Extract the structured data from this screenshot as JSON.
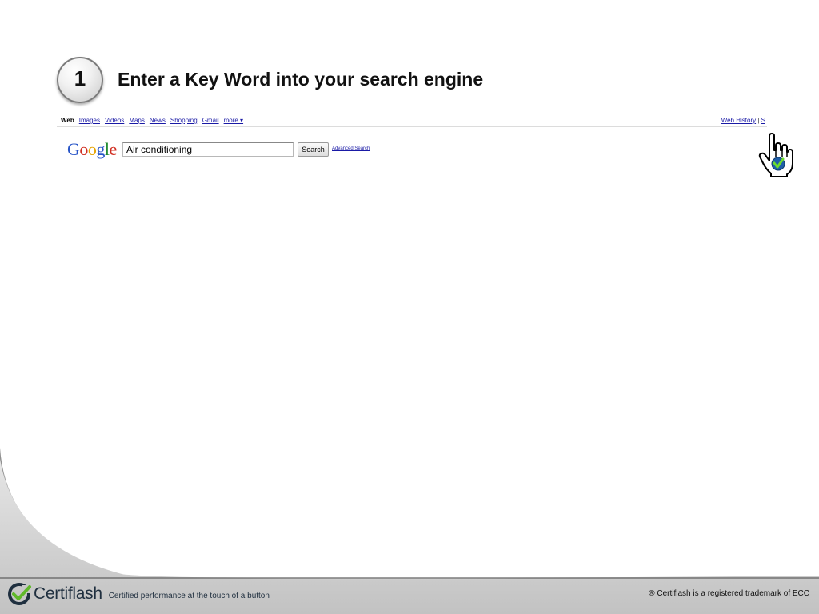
{
  "step": {
    "number": "1",
    "title": "Enter a Key Word into your search engine"
  },
  "google": {
    "nav": [
      "Web",
      "Images",
      "Videos",
      "Maps",
      "News",
      "Shopping",
      "Gmail",
      "more ▾"
    ],
    "active_nav": "Web",
    "right_links": {
      "web_history": "Web History",
      "separator": "|",
      "cut_off": "S"
    },
    "logo": [
      "G",
      "o",
      "o",
      "g",
      "l",
      "e"
    ],
    "search_value": "Air conditioning",
    "search_button": "Search",
    "advanced_link": "Advanced Search"
  },
  "footer": {
    "brand": "Certiflash",
    "tagline": "Certified performance at the touch of a button",
    "trademark": "® Certiflash is a registered trademark of ECC"
  },
  "colors": {
    "link": "#1a1aa6",
    "checkmark_green": "#4caf2a",
    "badge_blue": "#1f5fa8",
    "footer_gray": "#c8c8c8"
  },
  "icons": [
    "hand-pointer-icon",
    "certiflash-check-icon"
  ]
}
